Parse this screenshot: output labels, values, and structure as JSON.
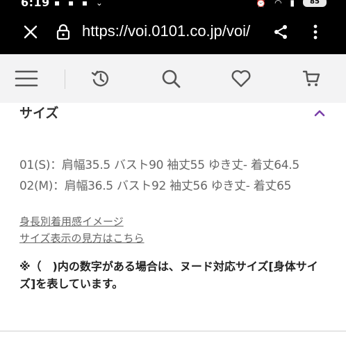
{
  "status_bar": {
    "time": "6:19",
    "battery": "85",
    "left_icons": [
      "notification-icon",
      "image-icon",
      "app-icon",
      "chevron-icon"
    ],
    "right_icons": [
      "alarm-icon",
      "wifi-icon",
      "signal-icon"
    ]
  },
  "browser": {
    "url": "https://voi.0101.co.jp/voi/",
    "icons": [
      "close-icon",
      "lock-icon",
      "share-icon",
      "more-icon"
    ]
  },
  "site_nav": {
    "icons": [
      "hamburger-menu-icon",
      "history-icon",
      "search-icon",
      "heart-icon",
      "cart-icon"
    ]
  },
  "section": {
    "title": "サイズ",
    "toggle_icon": "chevron-up-icon",
    "accent_color": "#7a3fa8"
  },
  "sizes": [
    "01(S)：肩幅35.5 バスト90 袖丈55 ゆき丈- 着丈64.5",
    "02(M)：肩幅36.5 バスト92 袖丈56 ゆき丈- 着丈65"
  ],
  "links": {
    "body_image": "身長別着用感イメージ",
    "size_guide": "サイズ表示の見方はこちら"
  },
  "note": "※（　)内の数字がある場合は、ヌード対応サイズ[身体サイズ]を表しています。"
}
